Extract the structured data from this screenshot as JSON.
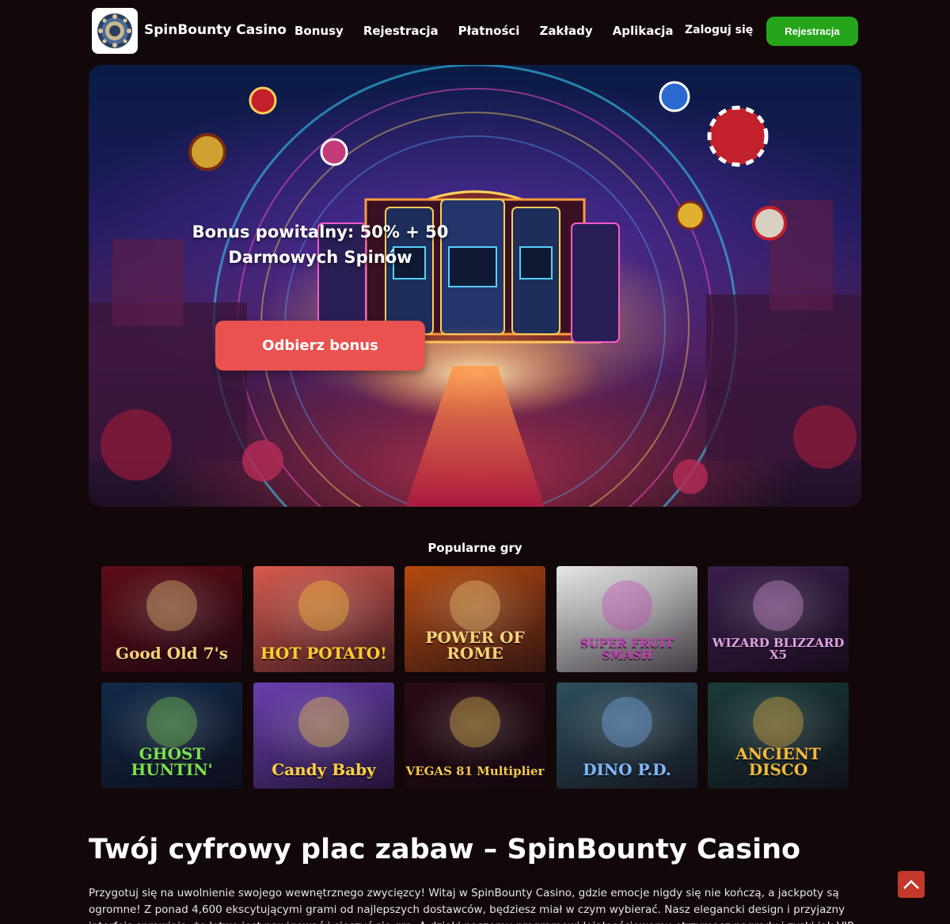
{
  "header": {
    "brand": "SpinBounty Casino",
    "nav": [
      "Bonusy",
      "Rejestracja",
      "Płatności",
      "Zakłady",
      "Aplikacja"
    ],
    "login": "Zaloguj się",
    "register": "Rejestracja"
  },
  "hero": {
    "title": "Bonus powitalny: 50% + 50 Darmowych Spinów",
    "button": "Odbierz bonus"
  },
  "popular": {
    "title": "Popularne gry",
    "games": [
      {
        "name": "Good Old 7's",
        "bg": "#5e0c16",
        "fg": "#f2d27a"
      },
      {
        "name": "HOT POTATO!",
        "bg": "#d75a4e",
        "fg": "#ffcf2e"
      },
      {
        "name": "POWER OF ROME",
        "bg": "#b54a10",
        "fg": "#f6d27b"
      },
      {
        "name": "SUPER FRUIT SMASH",
        "bg": "#e8e8e8",
        "fg": "#c43ab3"
      },
      {
        "name": "WIZARD BLIZZARD X5",
        "bg": "#3a1f4a",
        "fg": "#e3a0e6"
      },
      {
        "name": "GHOST HUNTIN'",
        "bg": "#102a48",
        "fg": "#7be04a"
      },
      {
        "name": "Candy Baby",
        "bg": "#6a3fb0",
        "fg": "#ffd33d"
      },
      {
        "name": "VEGAS 81 Multiplier",
        "bg": "#2a0a12",
        "fg": "#f2c84b"
      },
      {
        "name": "DINO P.D.",
        "bg": "#2d4f5c",
        "fg": "#7fb8ff"
      },
      {
        "name": "ANCIENT DISCO",
        "bg": "#1a3b3a",
        "fg": "#f5b93a"
      }
    ]
  },
  "article": {
    "title": "Twój cyfrowy plac zabaw – SpinBounty Casino",
    "body": "Przygotuj się na uwolnienie swojego wewnętrznego zwycięzcy! Witaj w SpinBounty Casino, gdzie emocje nigdy się nie kończą, a jackpoty są ogromne! Z ponad 4,600 ekscytującymi grami od najlepszych dostawców, będziesz miał w czym wybierać. Nasz elegancki design i przyjazny interfejs sprawiają, że łatwo jest nawigować i cieszyć się grą. A dzięki naszemu programowi lojalnościowemu otrzymasz nagrody i zyski jak VIP."
  }
}
